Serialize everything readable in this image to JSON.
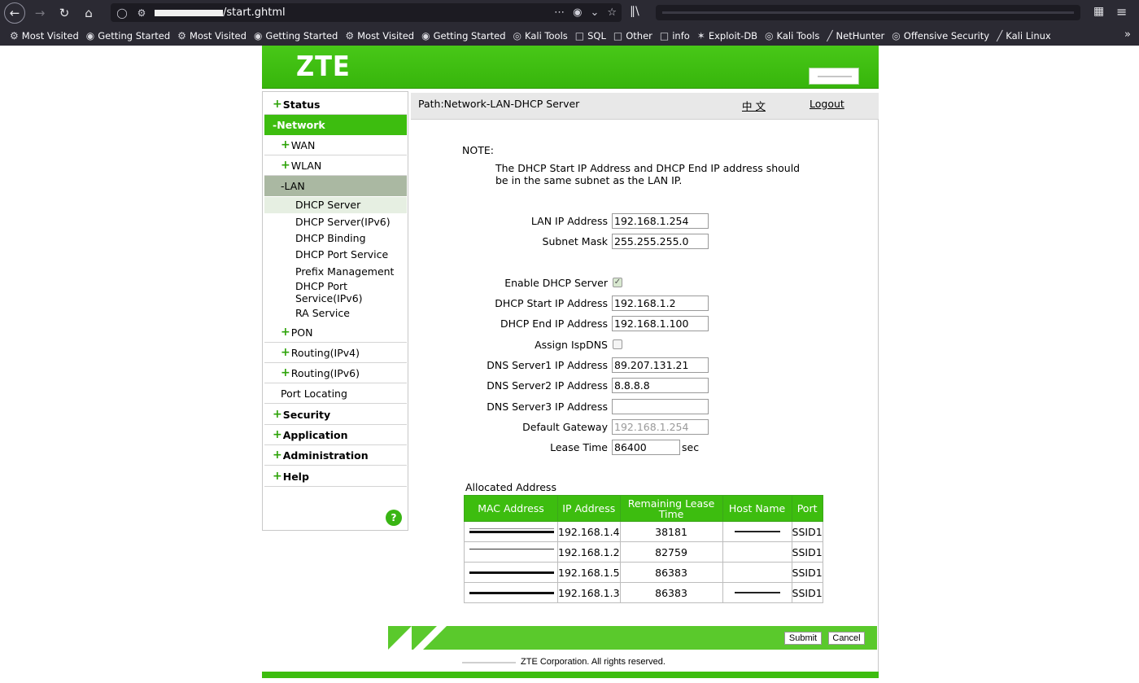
{
  "browser": {
    "url_path": "/start.ghtml",
    "bookmarks": [
      {
        "label": "Most Visited",
        "icon": "gear-icon"
      },
      {
        "label": "Getting Started",
        "icon": "firefox-icon"
      },
      {
        "label": "Most Visited",
        "icon": "gear-icon"
      },
      {
        "label": "Getting Started",
        "icon": "firefox-icon"
      },
      {
        "label": "Most Visited",
        "icon": "gear-icon"
      },
      {
        "label": "Getting Started",
        "icon": "firefox-icon"
      },
      {
        "label": "Kali Tools",
        "icon": "globe-icon"
      },
      {
        "label": "SQL",
        "icon": "folder-icon"
      },
      {
        "label": "Other",
        "icon": "folder-icon"
      },
      {
        "label": "info",
        "icon": "folder-icon"
      },
      {
        "label": "Exploit-DB",
        "icon": "exploitdb-icon"
      },
      {
        "label": "Kali Tools",
        "icon": "globe-icon"
      },
      {
        "label": "NetHunter",
        "icon": "nethunter-icon"
      },
      {
        "label": "Offensive Security",
        "icon": "globe-icon"
      },
      {
        "label": "Kali Linux",
        "icon": "kali-icon"
      }
    ],
    "overflow": "»"
  },
  "header": {
    "logo": "ZTE"
  },
  "sidebar": {
    "status": "Status",
    "network": "-Network",
    "wan": "WAN",
    "wlan": "WLAN",
    "lan": "-LAN",
    "lan_items": [
      "DHCP Server",
      "DHCP Server(IPv6)",
      "DHCP Binding",
      "DHCP Port Service",
      "Prefix Management",
      "DHCP Port Service(IPv6)",
      "RA Service"
    ],
    "pon": "PON",
    "routing4": "Routing(IPv4)",
    "routing6": "Routing(IPv6)",
    "port_locating": "Port Locating",
    "security": "Security",
    "application": "Application",
    "administration": "Administration",
    "help": "Help",
    "help_icon": "?"
  },
  "pathbar": {
    "path": "Path:Network-LAN-DHCP Server",
    "lang": "中 文",
    "logout": "Logout"
  },
  "note": {
    "label": "NOTE:",
    "text": "The DHCP Start IP Address and DHCP End IP address should be in the same subnet as the LAN IP."
  },
  "form": {
    "lan_ip_label": "LAN IP Address",
    "lan_ip": "192.168.1.254",
    "subnet_label": "Subnet Mask",
    "subnet": "255.255.255.0",
    "enable_dhcp_label": "Enable DHCP Server",
    "enable_dhcp": true,
    "start_label": "DHCP Start IP Address",
    "start": "192.168.1.2",
    "end_label": "DHCP End IP Address",
    "end": "192.168.1.100",
    "assign_isp_label": "Assign IspDNS",
    "assign_isp": false,
    "dns1_label": "DNS Server1 IP Address",
    "dns1": "89.207.131.21",
    "dns2_label": "DNS Server2 IP Address",
    "dns2": "8.8.8.8",
    "dns3_label": "DNS Server3 IP Address",
    "dns3": "",
    "gateway_label": "Default Gateway",
    "gateway": "192.168.1.254",
    "lease_label": "Lease Time",
    "lease": "86400",
    "lease_unit": "sec"
  },
  "allocated": {
    "title": "Allocated Address",
    "headers": [
      "MAC Address",
      "IP Address",
      "Remaining Lease Time",
      "Host Name",
      "Port"
    ],
    "rows": [
      {
        "ip": "192.168.1.4",
        "lease": "38181",
        "port": "SSID1"
      },
      {
        "ip": "192.168.1.2",
        "lease": "82759",
        "port": "SSID1"
      },
      {
        "ip": "192.168.1.5",
        "lease": "86383",
        "port": "SSID1"
      },
      {
        "ip": "192.168.1.3",
        "lease": "86383",
        "port": "SSID1"
      }
    ]
  },
  "buttons": {
    "submit": "Submit",
    "cancel": "Cancel"
  },
  "footer": {
    "copyright": "ZTE Corporation. All rights reserved."
  }
}
